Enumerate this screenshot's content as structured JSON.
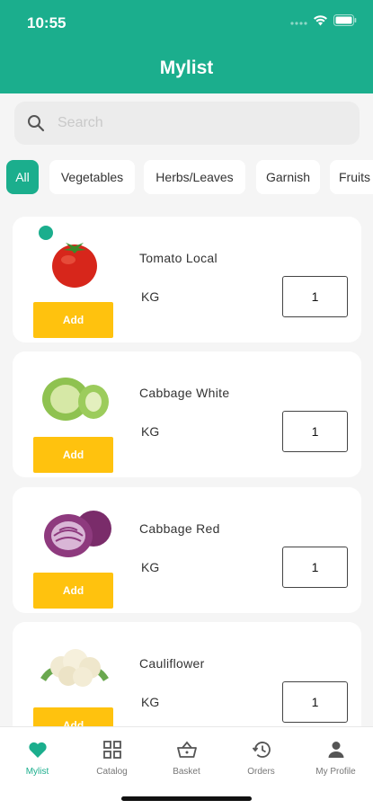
{
  "status_bar": {
    "time": "10:55"
  },
  "header": {
    "title": "Mylist"
  },
  "search": {
    "placeholder": "Search"
  },
  "categories": [
    "All",
    "Vegetables",
    "Herbs/Leaves",
    "Garnish",
    "Fruits"
  ],
  "products": [
    {
      "name": "Tomato Local",
      "unit": "KG",
      "quantity": "1",
      "add_label": "Add",
      "image": "tomato"
    },
    {
      "name": "Cabbage White",
      "unit": "KG",
      "quantity": "1",
      "add_label": "Add",
      "image": "white-cabbage"
    },
    {
      "name": "Cabbage Red",
      "unit": "KG",
      "quantity": "1",
      "add_label": "Add",
      "image": "red-cabbage"
    },
    {
      "name": "Cauliflower",
      "unit": "KG",
      "quantity": "1",
      "add_label": "Add",
      "image": "cauliflower"
    }
  ],
  "tabs": [
    {
      "label": "Mylist",
      "icon": "heart-icon",
      "active": true
    },
    {
      "label": "Catalog",
      "icon": "grid-icon",
      "active": false
    },
    {
      "label": "Basket",
      "icon": "basket-icon",
      "active": false
    },
    {
      "label": "Orders",
      "icon": "history-icon",
      "active": false
    },
    {
      "label": "My Profile",
      "icon": "person-icon",
      "active": false
    }
  ],
  "colors": {
    "primary": "#1bae8d",
    "add_button": "#ffc20e",
    "background": "#f5f5f5"
  }
}
